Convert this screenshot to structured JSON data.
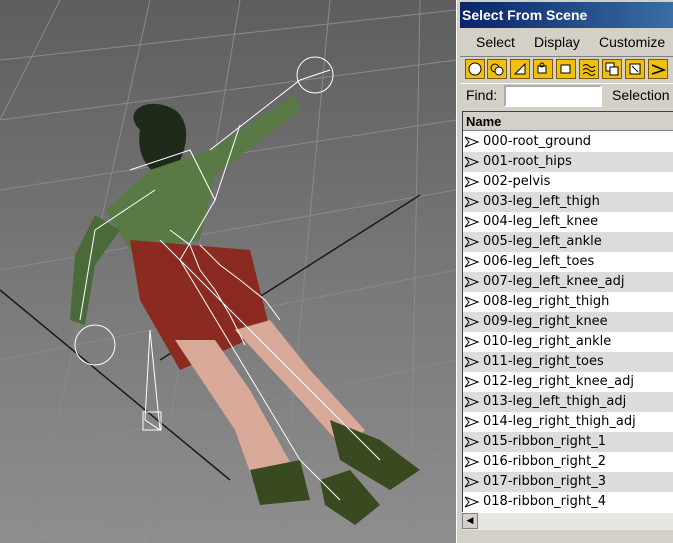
{
  "dialog": {
    "title": "Select From Scene",
    "menu": [
      "Select",
      "Display",
      "Customize"
    ],
    "toolbar_icons": [
      "circle-filter-icon",
      "overlap-filter-icon",
      "light-filter-icon",
      "camera-filter-icon",
      "helper-filter-icon",
      "spacewarp-filter-icon",
      "group-filter-icon",
      "xref-filter-icon",
      "bone-filter-icon"
    ],
    "find_label": "Find:",
    "find_value": "",
    "selection_label": "Selection",
    "column_header": "Name",
    "items": [
      "000-root_ground",
      "001-root_hips",
      "002-pelvis",
      "003-leg_left_thigh",
      "004-leg_left_knee",
      "005-leg_left_ankle",
      "006-leg_left_toes",
      "007-leg_left_knee_adj",
      "008-leg_right_thigh",
      "009-leg_right_knee",
      "010-leg_right_ankle",
      "011-leg_right_toes",
      "012-leg_right_knee_adj",
      "013-leg_left_thigh_adj",
      "014-leg_right_thigh_adj",
      "015-ribbon_right_1",
      "016-ribbon_right_2",
      "017-ribbon_right_3",
      "018-ribbon_right_4"
    ],
    "colors": {
      "title_start": "#0a246a",
      "title_end": "#3a6ea5",
      "panel": "#d4d0c8",
      "tool_bg": "#f0c010"
    }
  },
  "viewport": {
    "content": "3D character model with skeleton bones on grid"
  }
}
